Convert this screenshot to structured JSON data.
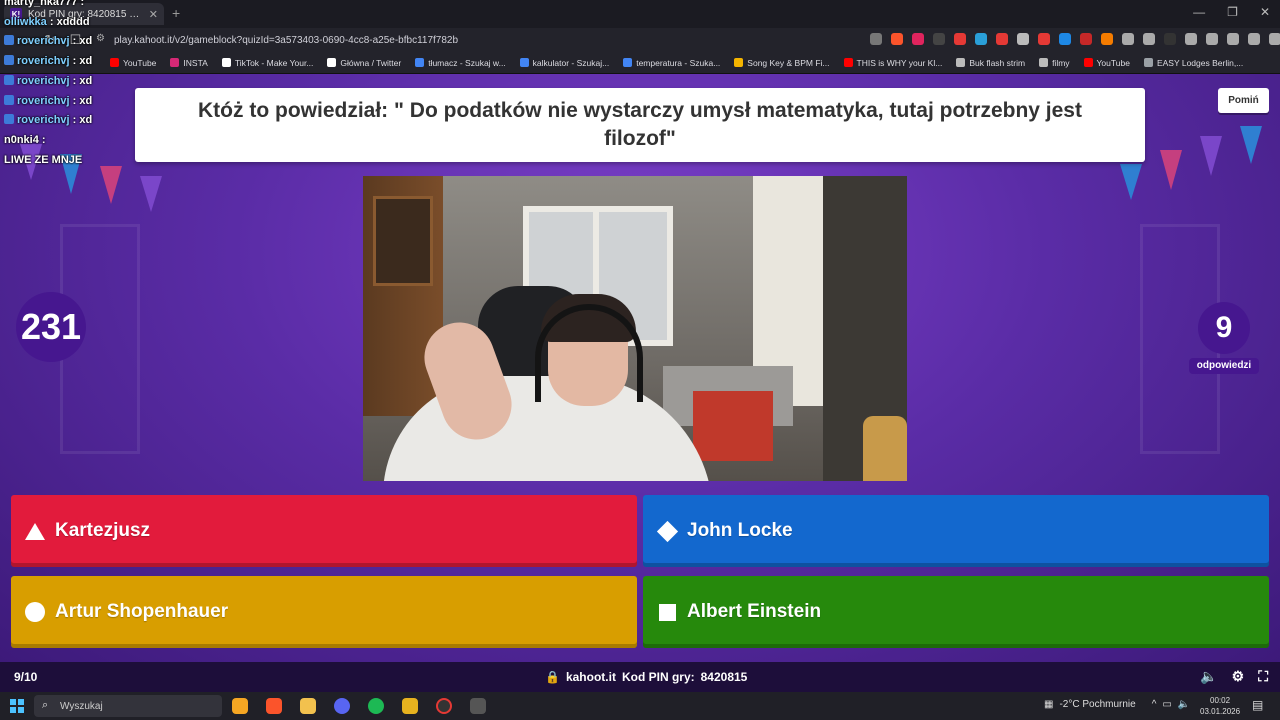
{
  "browser": {
    "tab_title": "Kod PIN gry: 8420815 — Oc...",
    "url": "play.kahoot.it/v2/gameblock?quizId=3a573403-0690-4cc8-a25e-bfbc117f782b",
    "bookmarks": [
      {
        "label": "YouTube",
        "color": "#ff0000"
      },
      {
        "label": "INSTA",
        "color": "#d62976"
      },
      {
        "label": "TikTok - Make Your...",
        "color": "#ffffff"
      },
      {
        "label": "Główna / Twitter",
        "color": "#ffffff"
      },
      {
        "label": "tłumacz - Szukaj w...",
        "color": "#4285f4"
      },
      {
        "label": "kalkulator - Szukaj...",
        "color": "#4285f4"
      },
      {
        "label": "temperatura - Szuka...",
        "color": "#4285f4"
      },
      {
        "label": "Song Key & BPM Fi...",
        "color": "#f4b400"
      },
      {
        "label": "THIS is WHY your Kl...",
        "color": "#ff0000"
      },
      {
        "label": "Buk flash strim",
        "color": "#bbbbbb"
      },
      {
        "label": "filmy",
        "color": "#bbbbbb"
      },
      {
        "label": "YouTube",
        "color": "#ff0000"
      },
      {
        "label": "EASY Lodges Berlin,...",
        "color": "#9aa0a6"
      }
    ]
  },
  "chat": [
    {
      "user": "marty_nka777",
      "msg": " :",
      "badge": false,
      "white": true
    },
    {
      "user": "olliwkka",
      "msg": " : xdddd",
      "badge": false,
      "white": false
    },
    {
      "user": "roverichvj",
      "msg": " : xd",
      "badge": true,
      "white": false
    },
    {
      "user": "roverichvj",
      "msg": " : xd",
      "badge": true,
      "white": false
    },
    {
      "user": "roverichvj",
      "msg": " : xd",
      "badge": true,
      "white": false
    },
    {
      "user": "roverichvj",
      "msg": " : xd",
      "badge": true,
      "white": false
    },
    {
      "user": "roverichvj",
      "msg": " : xd",
      "badge": true,
      "white": false
    },
    {
      "user": "n0nki4",
      "msg": " :",
      "badge": false,
      "white": true
    },
    {
      "user": "",
      "msg": "LIWE ZE MNJE",
      "badge": false,
      "white": true
    }
  ],
  "game": {
    "question": "Któż to powiedział: \" Do podatków nie wystarczy umysł matematyka, tutaj potrzebny jest filozof\"",
    "skip_label": "Pomiń",
    "timer": "231",
    "answers_count": "9",
    "answers_label": "odpowiedzi",
    "answers": [
      {
        "text": "Kartezjusz",
        "shape": "triangle",
        "color": "#e21b3c"
      },
      {
        "text": "John Locke",
        "shape": "diamond",
        "color": "#1368ce"
      },
      {
        "text": "Artur Shopenhauer",
        "shape": "circle",
        "color": "#d89e00"
      },
      {
        "text": "Albert Einstein",
        "shape": "square",
        "color": "#26890c"
      }
    ],
    "progress": "9/10",
    "site": "kahoot.it",
    "pin_label": "Kod PIN gry:",
    "pin": "8420815"
  },
  "taskbar": {
    "search_placeholder": "Wyszukaj",
    "weather": "-2°C  Pochmurnie",
    "time": "00:02",
    "date": "03.01.2026"
  }
}
